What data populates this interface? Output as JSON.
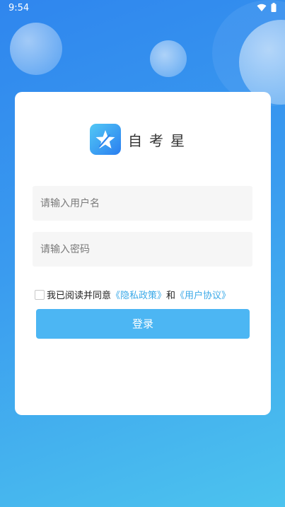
{
  "status_bar": {
    "time": "9:54",
    "icons": [
      "wifi-icon",
      "battery-icon"
    ]
  },
  "app": {
    "name": "自考星",
    "logo_icon": "star-logo-icon"
  },
  "login_form": {
    "username_placeholder": "请输入用户名",
    "password_placeholder": "请输入密码",
    "agree_prefix": "我已阅读并同意",
    "privacy_link": "《隐私政策》",
    "and_text": "和",
    "user_agreement_link": "《用户协议》",
    "login_label": "登录"
  },
  "colors": {
    "background_top": "#2f86ee",
    "background_bottom": "#4cc3ee",
    "login_button": "#4cb6f3",
    "link": "#3aa9e8"
  }
}
